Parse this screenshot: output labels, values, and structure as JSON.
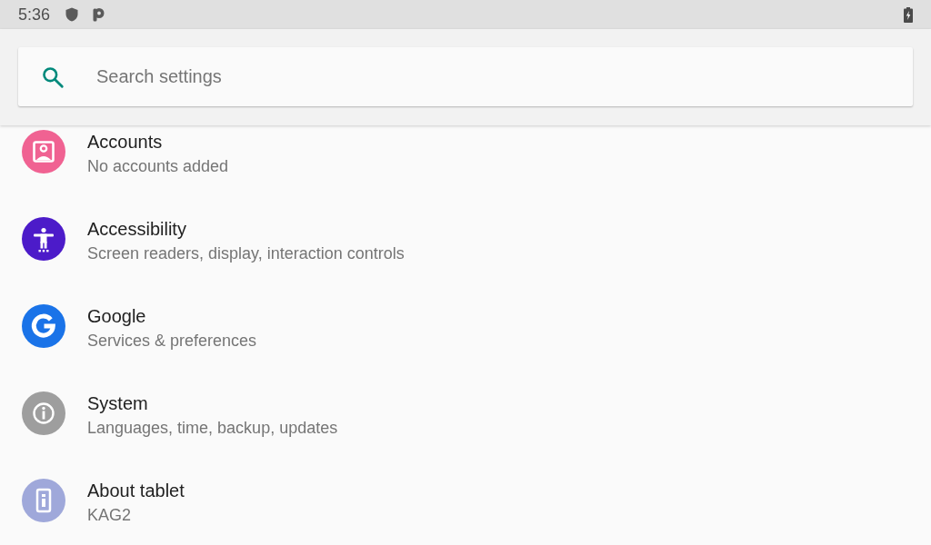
{
  "status_bar": {
    "time": "5:36"
  },
  "search": {
    "placeholder": "Search settings"
  },
  "items": [
    {
      "kind": "account",
      "color": "#f06292",
      "title": "Accounts",
      "summary": "No accounts added"
    },
    {
      "kind": "accessibility",
      "color": "#4c1bc9",
      "title": "Accessibility",
      "summary": "Screen readers, display, interaction controls"
    },
    {
      "kind": "google",
      "color": "#1a73e8",
      "title": "Google",
      "summary": "Services & preferences"
    },
    {
      "kind": "info",
      "color": "#9e9e9e",
      "title": "System",
      "summary": "Languages, time, backup, updates"
    },
    {
      "kind": "device",
      "color": "#9fa8da",
      "title": "About tablet",
      "summary": "KAG2"
    }
  ]
}
